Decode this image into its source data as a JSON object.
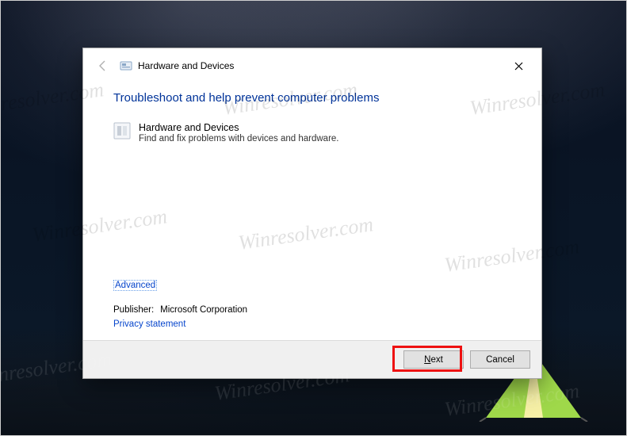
{
  "titlebar": {
    "title": "Hardware and Devices"
  },
  "content": {
    "heading": "Troubleshoot and help prevent computer problems",
    "item": {
      "title": "Hardware and Devices",
      "description": "Find and fix problems with devices and hardware."
    },
    "advanced": "Advanced",
    "publisher_label": "Publisher:",
    "publisher_value": "Microsoft Corporation",
    "privacy": "Privacy statement"
  },
  "footer": {
    "next_u": "N",
    "next_rest": "ext",
    "cancel": "Cancel"
  },
  "watermark": "Winresolver.com"
}
